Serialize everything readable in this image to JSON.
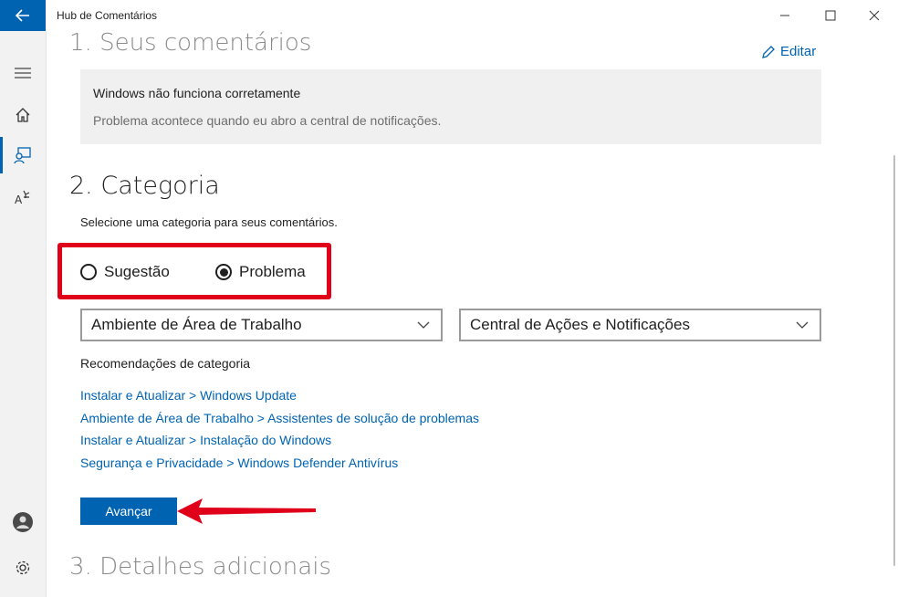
{
  "window": {
    "title": "Hub de Comentários"
  },
  "nav": {
    "items": [
      {
        "name": "menu-icon"
      },
      {
        "name": "home-icon"
      },
      {
        "name": "feedback-icon",
        "selected": true
      },
      {
        "name": "announcements-icon"
      },
      {
        "name": "account-icon"
      },
      {
        "name": "settings-icon"
      }
    ]
  },
  "section1": {
    "title": "1. Seus comentários",
    "edit_label": "Editar",
    "feedback_title": "Windows não funciona corretamente",
    "feedback_desc": "Problema acontece quando eu abro a central de notificações."
  },
  "section2": {
    "title": "2. Categoria",
    "hint": "Selecione uma categoria para seus comentários.",
    "radio_suggestion": "Sugestão",
    "radio_problem": "Problema",
    "selected": "Problema",
    "category_select": "Ambiente de Área de Trabalho",
    "subcategory_select": "Central de Ações e Notificações",
    "rec_title": "Recomendações de categoria",
    "recommendations": [
      "Instalar e Atualizar > Windows Update",
      "Ambiente de Área de Trabalho > Assistentes de solução de problemas",
      "Instalar e Atualizar > Instalação do Windows",
      "Segurança e Privacidade > Windows Defender Antivírus"
    ],
    "next_label": "Avançar"
  },
  "section3": {
    "title": "3. Detalhes adicionais"
  },
  "colors": {
    "accent": "#0063b1",
    "highlight": "#e0001a"
  }
}
